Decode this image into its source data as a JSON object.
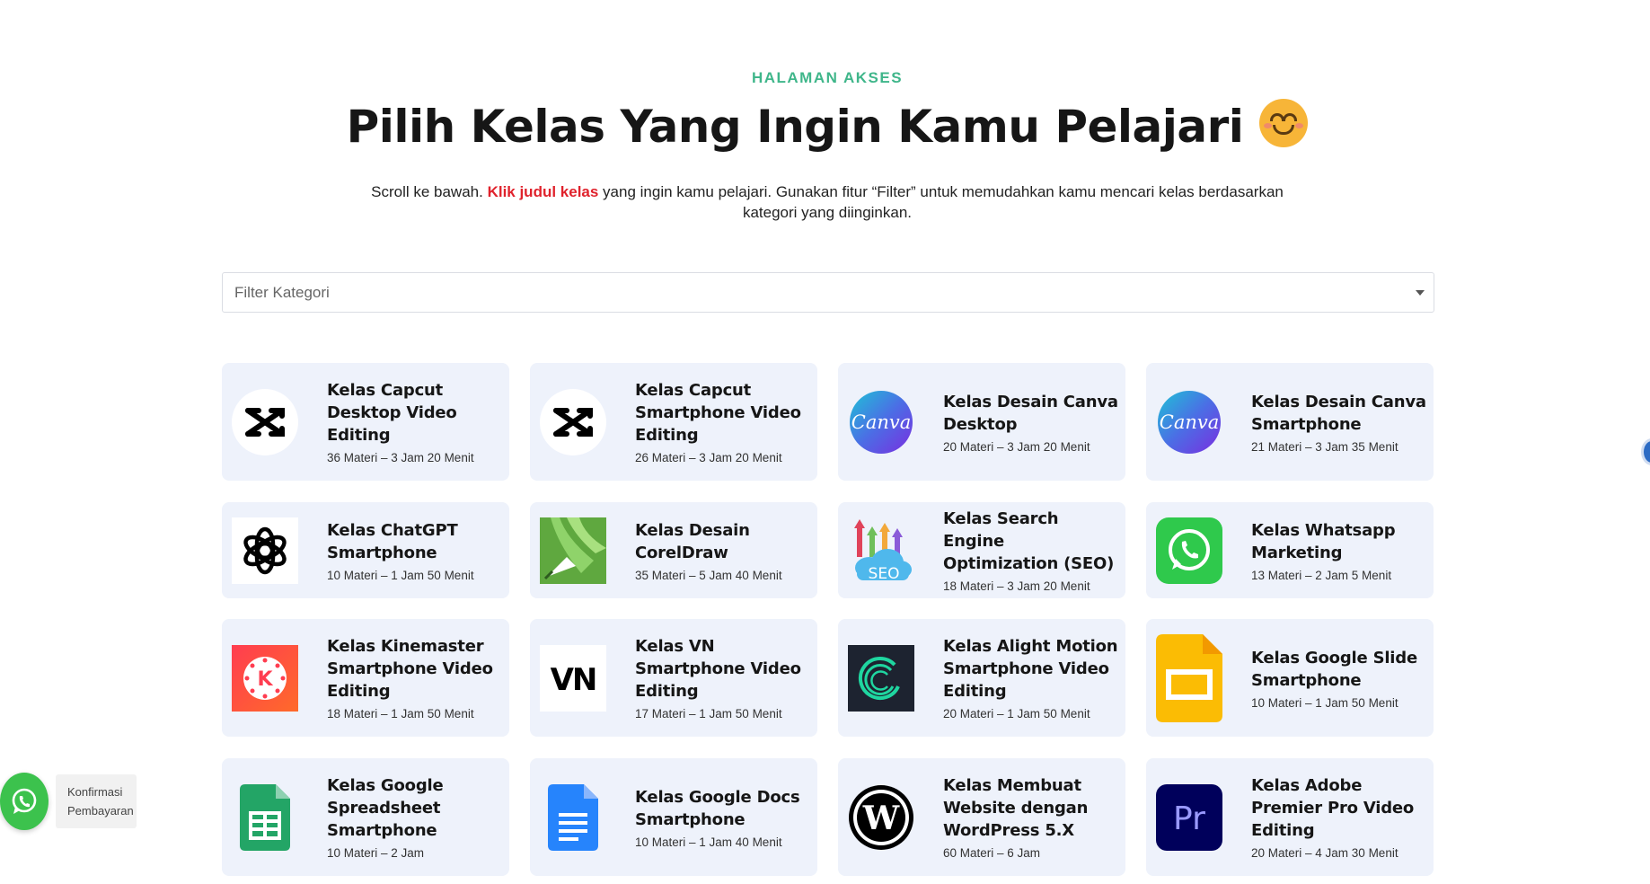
{
  "header": {
    "eyebrow": "HALAMAN AKSES",
    "title": "Pilih Kelas Yang Ingin Kamu Pelajari",
    "title_emoji": "smiling-face-emoji",
    "intro_before": "Scroll ke bawah. ",
    "intro_highlight": "Klik judul kelas",
    "intro_after": " yang ingin kamu pelajari. Gunakan fitur “Filter” untuk memudahkan kamu mencari kelas berdasarkan kategori yang diinginkan.",
    "highlight_color": "#e0222c",
    "eyebrow_color": "#3fb68a"
  },
  "filter": {
    "placeholder": "Filter Kategori"
  },
  "courses": [
    {
      "icon": "capcut-icon",
      "title": "Kelas Capcut Desktop Video Editing",
      "meta": "36 Materi – 3 Jam 20 Menit"
    },
    {
      "icon": "capcut-icon",
      "title": "Kelas Capcut Smartphone Video Editing",
      "meta": "26 Materi – 3 Jam 20 Menit"
    },
    {
      "icon": "canva-icon",
      "title": "Kelas Desain Canva Desktop",
      "meta": "20 Materi – 3 Jam 20 Menit"
    },
    {
      "icon": "canva-icon",
      "title": "Kelas Desain Canva Smartphone",
      "meta": "21 Materi – 3 Jam 35 Menit"
    },
    {
      "icon": "chatgpt-icon",
      "title": "Kelas ChatGPT Smartphone",
      "meta": "10 Materi – 1 Jam 50 Menit"
    },
    {
      "icon": "coreldraw-icon",
      "title": "Kelas Desain CorelDraw",
      "meta": "35 Materi – 5 Jam 40 Menit"
    },
    {
      "icon": "seo-cloud-icon",
      "title": "Kelas Search Engine Optimization (SEO)",
      "meta": "18 Materi – 3 Jam 20 Menit"
    },
    {
      "icon": "whatsapp-icon",
      "title": "Kelas Whatsapp Marketing",
      "meta": "13 Materi – 2 Jam 5 Menit"
    },
    {
      "icon": "kinemaster-icon",
      "title": "Kelas Kinemaster Smartphone Video Editing",
      "meta": "18 Materi – 1 Jam 50 Menit"
    },
    {
      "icon": "vn-icon",
      "title": "Kelas VN Smartphone Video Editing",
      "meta": "17 Materi – 1 Jam 50 Menit"
    },
    {
      "icon": "alight-motion-icon",
      "title": "Kelas Alight Motion Smartphone Video Editing",
      "meta": "20 Materi – 1 Jam 50 Menit"
    },
    {
      "icon": "google-slides-icon",
      "title": "Kelas Google Slide Smartphone",
      "meta": "10 Materi – 1 Jam 50 Menit"
    },
    {
      "icon": "google-sheets-icon",
      "title": "Kelas Google Spreadsheet Smartphone",
      "meta": "10 Materi – 2 Jam"
    },
    {
      "icon": "google-docs-icon",
      "title": "Kelas Google Docs Smartphone",
      "meta": "10 Materi – 1 Jam 40 Menit"
    },
    {
      "icon": "wordpress-icon",
      "title": "Kelas Membuat Website dengan WordPress 5.X",
      "meta": "60 Materi – 6 Jam"
    },
    {
      "icon": "premiere-pro-icon",
      "title": "Kelas Adobe Premier Pro Video Editing",
      "meta": "20 Materi – 4 Jam 30 Menit"
    }
  ],
  "widget": {
    "label_line1": "Konfirmasi",
    "label_line2": "Pembayaran",
    "icon": "whatsapp-icon"
  },
  "colors": {
    "card_bg": "#eef2fb",
    "whatsapp_green": "#3cc24d"
  }
}
